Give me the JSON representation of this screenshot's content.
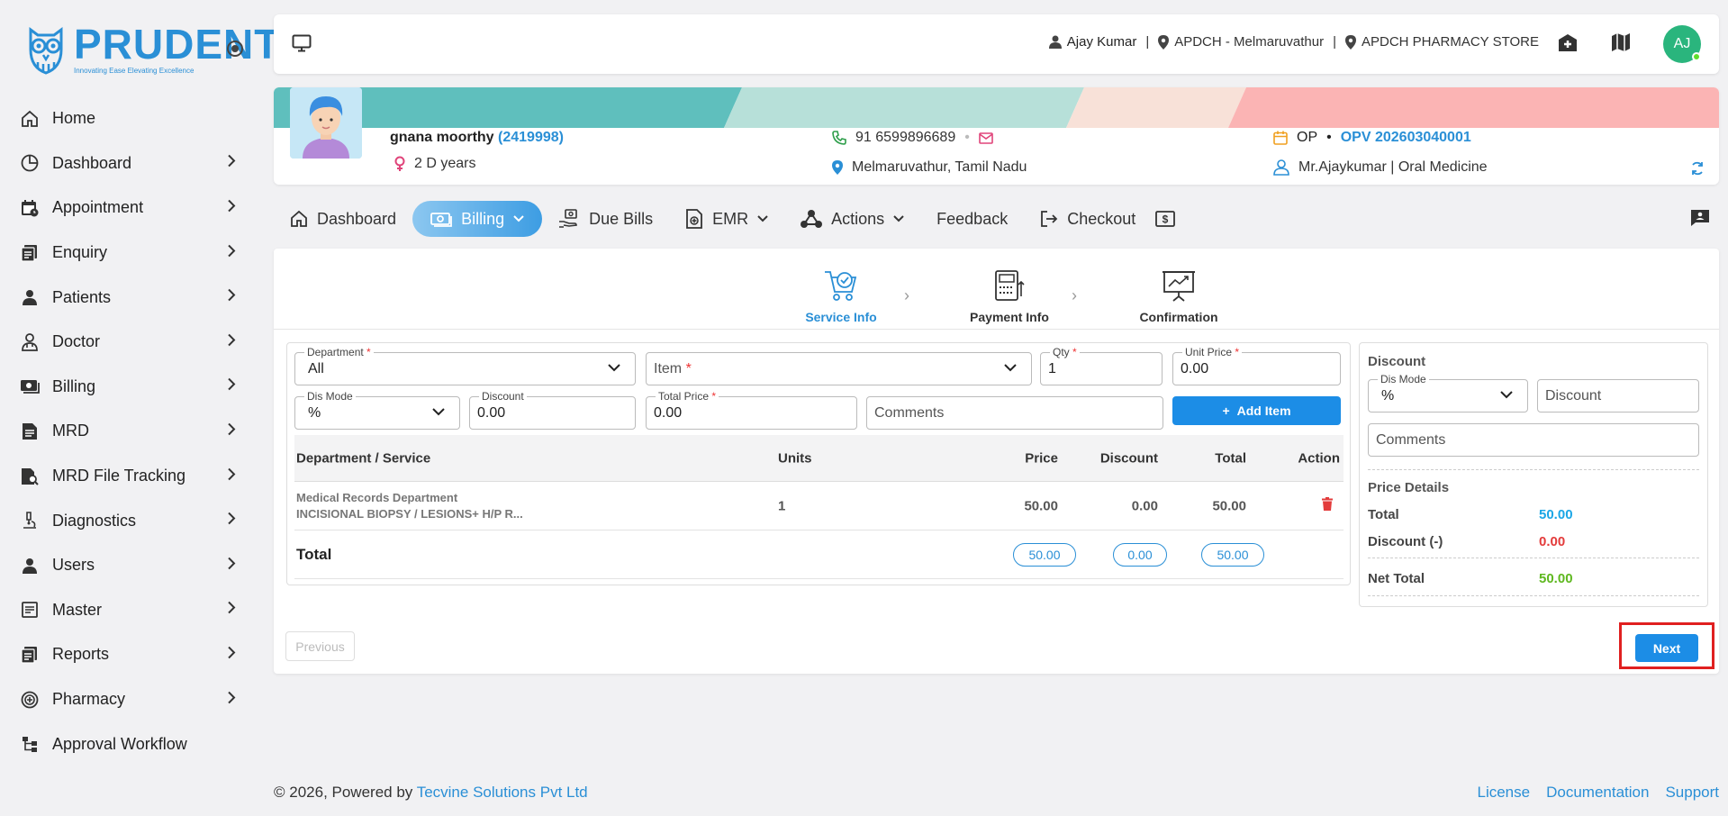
{
  "brand": {
    "name": "PRUDENT",
    "tagline": "Innovating Ease Elevating Excellence"
  },
  "sidebar": {
    "items": [
      {
        "label": "Home",
        "icon": "home-icon",
        "chevron": false
      },
      {
        "label": "Dashboard",
        "icon": "pie-chart-icon",
        "chevron": true
      },
      {
        "label": "Appointment",
        "icon": "calendar-clock-icon",
        "chevron": true
      },
      {
        "label": "Enquiry",
        "icon": "document-stack-icon",
        "chevron": true
      },
      {
        "label": "Patients",
        "icon": "person-icon",
        "chevron": true
      },
      {
        "label": "Doctor",
        "icon": "doctor-icon",
        "chevron": true
      },
      {
        "label": "Billing",
        "icon": "money-icon",
        "chevron": true
      },
      {
        "label": "MRD",
        "icon": "file-text-icon",
        "chevron": true
      },
      {
        "label": "MRD File Tracking",
        "icon": "file-search-icon",
        "chevron": true
      },
      {
        "label": "Diagnostics",
        "icon": "microscope-icon",
        "chevron": true
      },
      {
        "label": "Users",
        "icon": "person-icon",
        "chevron": true
      },
      {
        "label": "Master",
        "icon": "list-box-icon",
        "chevron": true
      },
      {
        "label": "Reports",
        "icon": "document-stack-icon",
        "chevron": true
      },
      {
        "label": "Pharmacy",
        "icon": "pharmacy-icon",
        "chevron": true
      },
      {
        "label": "Approval Workflow",
        "icon": "workflow-icon",
        "chevron": false
      }
    ]
  },
  "topbar": {
    "user": "Ajay Kumar",
    "location": "APDCH - Melmaruvathur",
    "store": "APDCH PHARMACY STORE",
    "avatar_initials": "AJ"
  },
  "patient": {
    "name": "gnana moorthy",
    "id": "(2419998)",
    "age": "2 D years",
    "phone": "91 6599896689",
    "address": "Melmaruvathur, Tamil Nadu",
    "visit_type": "OP",
    "visit_id": "OPV 202603040001",
    "doctor": "Mr.Ajaykumar | Oral Medicine"
  },
  "tabs": [
    {
      "label": "Dashboard",
      "icon": "home-icon"
    },
    {
      "label": "Billing",
      "icon": "cash-icon"
    },
    {
      "label": "Due Bills",
      "icon": "hand-money-icon"
    },
    {
      "label": "EMR",
      "icon": "medical-file-icon"
    },
    {
      "label": "Actions",
      "icon": "hub-icon"
    },
    {
      "label": "Feedback",
      "icon": ""
    },
    {
      "label": "Checkout",
      "icon": "logout-icon"
    }
  ],
  "steps": [
    {
      "label": "Service Info"
    },
    {
      "label": "Payment Info"
    },
    {
      "label": "Confirmation"
    }
  ],
  "form": {
    "department_label": "Department",
    "department_value": "All",
    "item_placeholder": "Item",
    "qty_label": "Qty",
    "qty_value": "1",
    "unit_price_label": "Unit Price",
    "unit_price_value": "0.00",
    "dis_mode_label": "Dis Mode",
    "dis_mode_value": "%",
    "discount_label": "Discount",
    "discount_value": "0.00",
    "total_price_label": "Total Price",
    "total_price_value": "0.00",
    "comments_placeholder": "Comments",
    "add_item_label": "Add Item"
  },
  "table": {
    "headers": {
      "service": "Department / Service",
      "units": "Units",
      "price": "Price",
      "discount": "Discount",
      "total": "Total",
      "action": "Action"
    },
    "rows": [
      {
        "department": "Medical Records Department",
        "service": "INCISIONAL BIOPSY / LESIONS+ H/P R...",
        "units": "1",
        "price": "50.00",
        "discount": "0.00",
        "total": "50.00"
      }
    ],
    "total_label": "Total",
    "total_price": "50.00",
    "total_discount": "0.00",
    "total_total": "50.00"
  },
  "side": {
    "title": "Discount",
    "dis_mode_label": "Dis Mode",
    "dis_mode_value": "%",
    "discount_placeholder": "Discount",
    "comments_placeholder": "Comments",
    "price_details_title": "Price Details",
    "total_label": "Total",
    "total_value": "50.00",
    "discount_label": "Discount (-)",
    "discount_value": "0.00",
    "net_total_label": "Net Total",
    "net_total_value": "50.00"
  },
  "buttons": {
    "previous": "Previous",
    "next": "Next"
  },
  "footer": {
    "copyright": "© 2026, Powered by ",
    "company": "Tecvine Solutions Pvt Ltd",
    "links": [
      "License",
      "Documentation",
      "Support"
    ]
  },
  "colors": {
    "primary": "#1c8de6",
    "link": "#2a8fd6",
    "danger": "#e33b3b",
    "success": "#5fb820",
    "highlight": "#e02020"
  }
}
